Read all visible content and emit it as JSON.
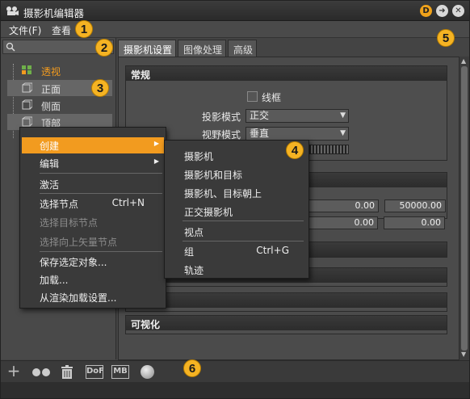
{
  "window": {
    "title": "摄影机编辑器"
  },
  "titlebar_buttons": {
    "d": "D",
    "arrow": "➜",
    "close": "✕"
  },
  "menu": {
    "file": "文件(F)",
    "view": "查看"
  },
  "search": {
    "placeholder": ""
  },
  "tree": {
    "items": [
      {
        "label": "透视"
      },
      {
        "label": "正面"
      },
      {
        "label": "侧面"
      },
      {
        "label": "顶部"
      }
    ]
  },
  "tabs": [
    "摄影机设置",
    "图像处理",
    "高级"
  ],
  "general": {
    "header": "常规",
    "wireframe_label": "线框",
    "projection_label": "投影模式",
    "projection_value": "正交",
    "view_label": "视野模式",
    "view_value": "垂直"
  },
  "ranges": {
    "v1": "0.00",
    "v2": "50000.00",
    "v3": "0.00",
    "v4": "0.00"
  },
  "visualization": {
    "header": "可视化"
  },
  "context_menu": {
    "items": [
      {
        "label": "创建",
        "shortcut": "",
        "submenu": "▶"
      },
      {
        "label": "编辑",
        "shortcut": "",
        "submenu": "▶"
      },
      {
        "label": "激活",
        "shortcut": "",
        "submenu": ""
      },
      {
        "label": "选择节点",
        "shortcut": "Ctrl+N",
        "submenu": ""
      },
      {
        "label": "选择目标节点",
        "shortcut": "",
        "submenu": ""
      },
      {
        "label": "选择向上矢量节点",
        "shortcut": "",
        "submenu": ""
      },
      {
        "label": "保存选定对象...",
        "shortcut": "",
        "submenu": ""
      },
      {
        "label": "加载...",
        "shortcut": "",
        "submenu": ""
      },
      {
        "label": "从渲染加载设置...",
        "shortcut": "",
        "submenu": ""
      }
    ]
  },
  "submenu": {
    "items": [
      {
        "label": "摄影机",
        "shortcut": ""
      },
      {
        "label": "摄影机和目标",
        "shortcut": ""
      },
      {
        "label": "摄影机、目标朝上",
        "shortcut": ""
      },
      {
        "label": "正交摄影机",
        "shortcut": ""
      },
      {
        "label": "视点",
        "shortcut": ""
      },
      {
        "label": "组",
        "shortcut": "Ctrl+G"
      },
      {
        "label": "轨迹",
        "shortcut": ""
      }
    ]
  },
  "bottom_toolbar": {
    "add": "+",
    "dof": "DoF",
    "mb": "MB"
  },
  "callouts": [
    "1",
    "2",
    "3",
    "4",
    "5",
    "6"
  ],
  "colors": {
    "accent": "#f29b1f",
    "badge": "#f5b323"
  }
}
